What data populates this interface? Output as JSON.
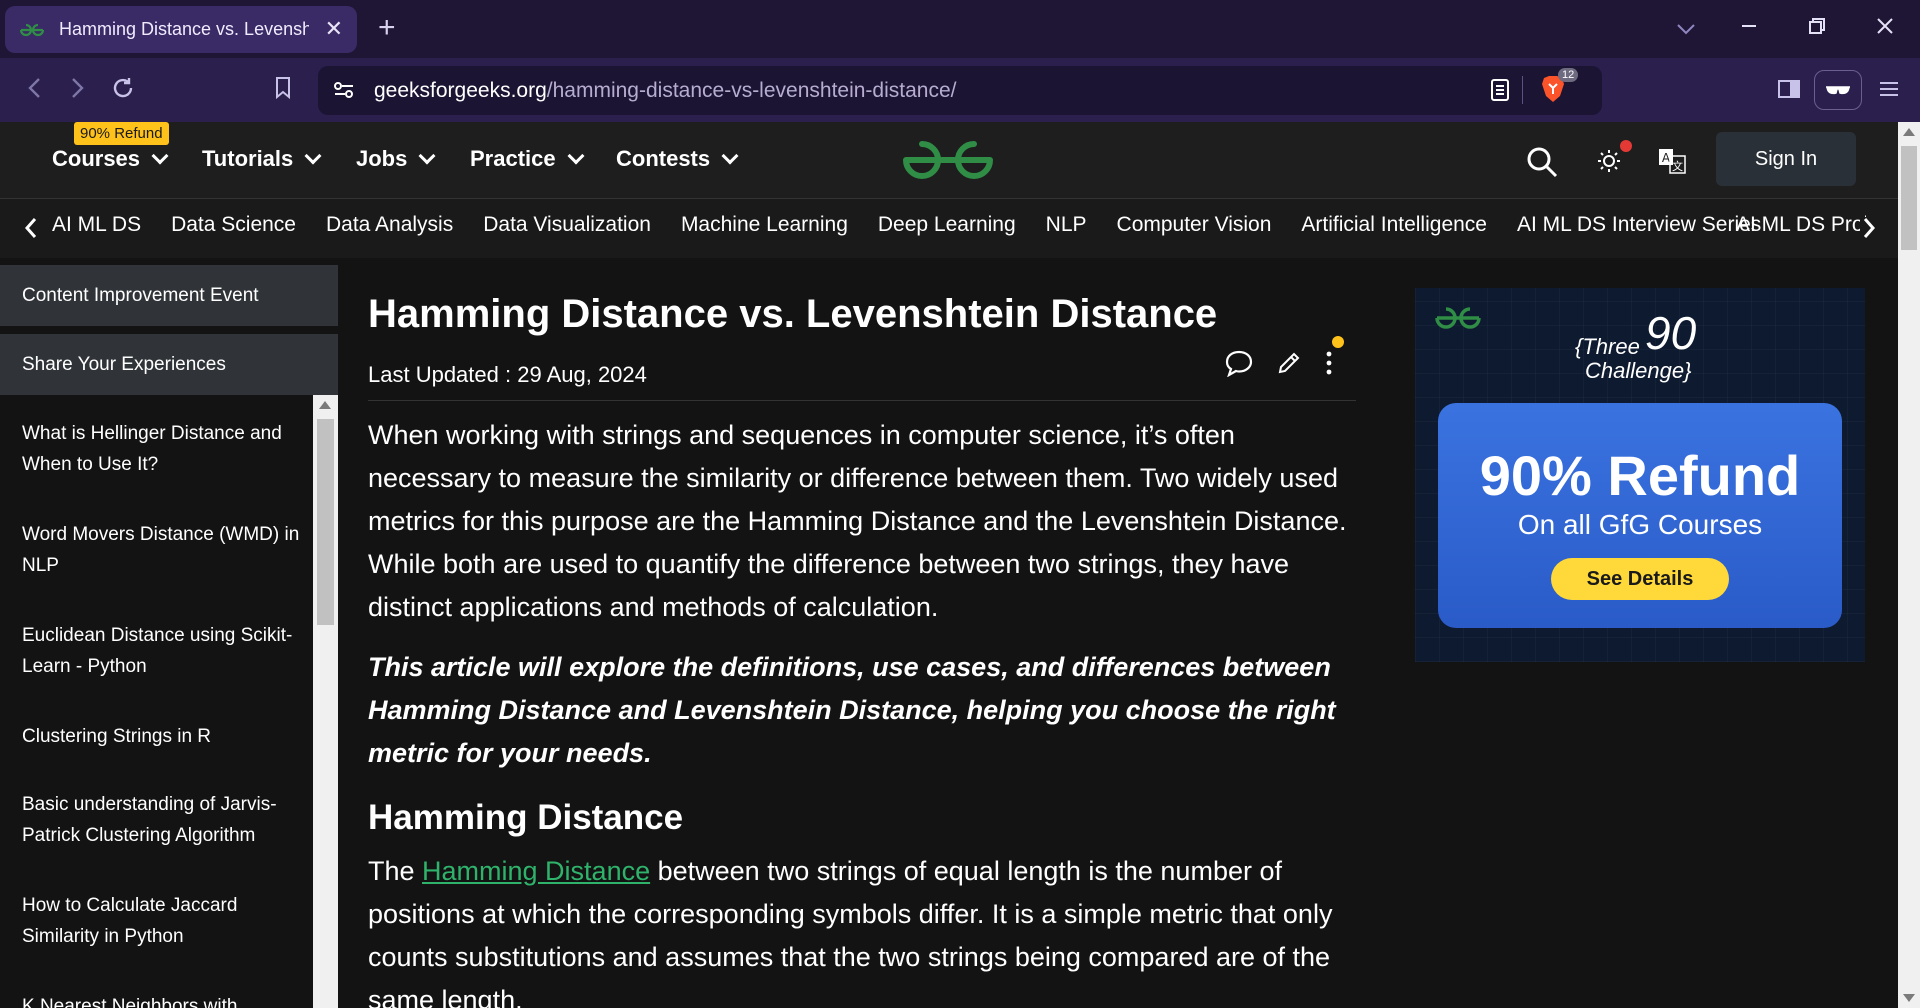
{
  "browser": {
    "tab_title": "Hamming Distance vs. Levenshtein Distance",
    "url_host": "geeksforgeeks.org",
    "url_path": "/hamming-distance-vs-levenshtein-distance/",
    "brave_badge": "12",
    "new_tab": "+",
    "close": "✕"
  },
  "header": {
    "badge": "90% Refund",
    "nav": [
      "Courses",
      "Tutorials",
      "Jobs",
      "Practice",
      "Contests"
    ],
    "sign_in": "Sign In"
  },
  "subnav": {
    "items": [
      "AI ML DS",
      "Data Science",
      "Data Analysis",
      "Data Visualization",
      "Machine Learning",
      "Deep Learning",
      "NLP",
      "Computer Vision",
      "Artificial Intelligence",
      "AI ML DS Interview Series",
      "AI ML DS Projects"
    ]
  },
  "sidebar": {
    "top_items": [
      "Content Improvement Event",
      "Share Your Experiences"
    ],
    "items": [
      "What is Hellinger Distance and When to Use It?",
      "Word Movers Distance (WMD) in NLP",
      "Euclidean Distance using Scikit-Learn - Python",
      "Clustering Strings in R",
      "Basic understanding of Jarvis-Patrick Clustering Algorithm",
      "How to Calculate Jaccard Similarity in Python",
      "K Nearest Neighbors with"
    ]
  },
  "article": {
    "title": "Hamming Distance vs. Levenshtein Distance",
    "updated": "Last Updated : 29 Aug, 2024",
    "intro": "When working with strings and sequences in computer science, it’s often necessary to measure the similarity or difference between them. Two widely used metrics for this purpose are the Hamming Distance and the Levenshtein Distance. While both are used to quantify the difference between two strings, they have distinct applications and methods of calculation.",
    "emphasis": "This article will explore the definitions, use cases, and differences between Hamming Distance and Levenshtein Distance, helping you choose the right metric for your needs.",
    "h2": "Hamming Distance",
    "p3_before": "The ",
    "p3_link": "Hamming Distance",
    "p3_after": " between two strings of equal length is the number of positions at which the corresponding symbols differ. It is a simple metric that only counts substitutions and assumes that the two strings being compared are of the same length."
  },
  "ad": {
    "three": "{Three",
    "challenge": "Challenge}",
    "ninety": "90",
    "refund": "90% Refund",
    "sub": "On all GfG Courses",
    "button": "See Details"
  },
  "colors": {
    "gfg_green": "#2f8d46",
    "link_green": "#2fb36b",
    "badge_yellow": "#ffc21a",
    "brave_orange": "#fb542b"
  }
}
